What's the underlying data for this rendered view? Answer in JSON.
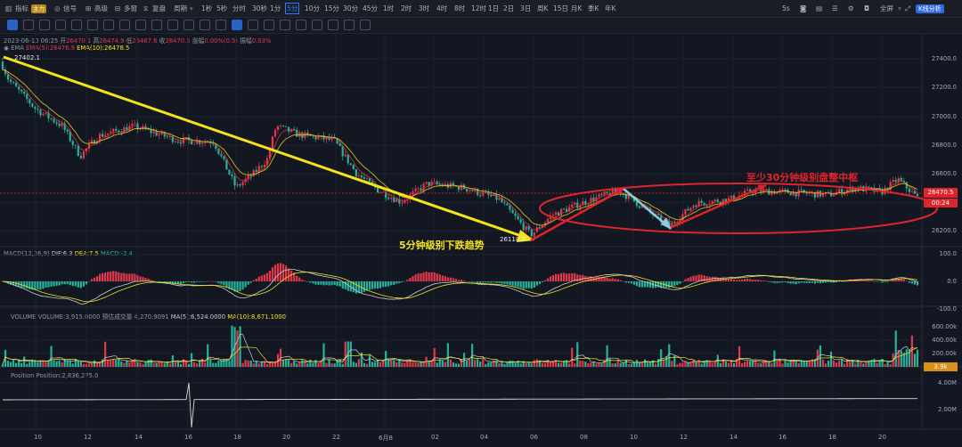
{
  "toolbar": {
    "indicators": "指标",
    "main_tag": "主力",
    "signal": "信号",
    "advanced": "高级",
    "multi_window": "多窗",
    "replay": "复盘",
    "cycle": "周期",
    "intervals": [
      "1秒",
      "5秒",
      "分时",
      "30秒",
      "1分",
      "5分",
      "10分",
      "15分",
      "30分",
      "45分",
      "1时",
      "2时",
      "3时",
      "4时",
      "8时",
      "12时",
      "1日",
      "2日",
      "3日",
      "周K",
      "15日",
      "月K",
      "季K",
      "年K"
    ],
    "active_interval": "5分",
    "right_interval": "5s",
    "fullscreen": "全屏",
    "k_analysis": "K线分析"
  },
  "info": {
    "datetime": "2023-06-10 06:25",
    "open_label": "开",
    "open": "26470.1",
    "high_label": "高",
    "high": "26474.9",
    "low_label": "低",
    "low": "26467.6",
    "close_label": "收",
    "close": "26470.5",
    "change_label": "涨幅",
    "change": "0.00%(0.5)",
    "amplitude_label": "振幅",
    "amplitude": "0.03%"
  },
  "ema": {
    "name": "EMA",
    "ema5": "EMA(5):26476.9",
    "ema10": "EMA(10):26478.5"
  },
  "macd": {
    "name": "MACD(12,26,9)",
    "dif": "DIF:6.3",
    "dea": "DEA:7.5",
    "macd": "MACD:-2.4"
  },
  "volume": {
    "name": "VOLUME",
    "volume": "VOLUME:3,915.0000",
    "est": "预估成交量 4,270.9091",
    "ma5": "MA(5):6,524.0000",
    "ma10": "MA(10):8,671.1000"
  },
  "position": {
    "name": "Position",
    "value": "Position:2,836,275.0"
  },
  "price_axis": [
    "27400.0",
    "27200.0",
    "27000.0",
    "26800.0",
    "26600.0",
    "26400.0",
    "26200.0"
  ],
  "macd_axis": [
    "100.0",
    "0.0",
    "-100.0"
  ],
  "volume_axis": [
    "600.00k",
    "400.00k",
    "200.00k"
  ],
  "position_axis": [
    "4.00M",
    "2.00M"
  ],
  "last_price": "26470.5",
  "countdown": "00:24",
  "volume_tag": "3.9k",
  "time_axis": [
    "10",
    "12",
    "14",
    "16",
    "18",
    "20",
    "22",
    "6月8",
    "02",
    "04",
    "06",
    "08",
    "10",
    "12",
    "14",
    "16",
    "18",
    "20"
  ],
  "high_mark": "27402.1",
  "low_mark": "26118.2",
  "annotations": {
    "downtrend": "5分钟级别下跌趋势",
    "consolidation": "至少30分钟级别盘整中枢"
  },
  "colors": {
    "up": "#e0384a",
    "down": "#26b29a",
    "yellow": "#f5e21a",
    "red": "#e0242c",
    "blue_arrow": "#8ecbe8",
    "background": "#131722"
  }
}
